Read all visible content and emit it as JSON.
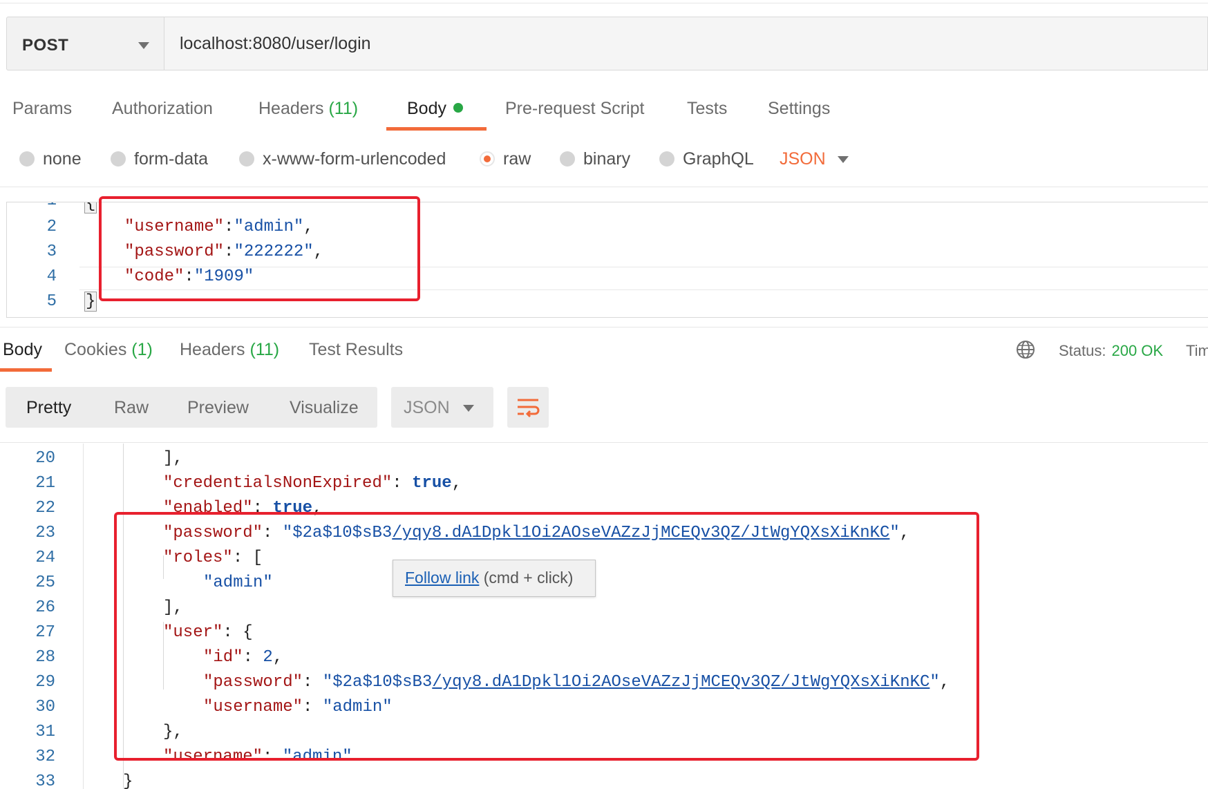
{
  "request": {
    "method": "POST",
    "url": "localhost:8080/user/login"
  },
  "request_tabs": {
    "params": "Params",
    "authorization": "Authorization",
    "headers": "Headers",
    "headers_count": "(11)",
    "body": "Body",
    "pre_request": "Pre-request Script",
    "tests": "Tests",
    "settings": "Settings"
  },
  "body_types": {
    "none": "none",
    "form_data": "form-data",
    "urlencoded": "x-www-form-urlencoded",
    "raw": "raw",
    "binary": "binary",
    "graphql": "GraphQL",
    "format": "JSON",
    "selected": "raw"
  },
  "request_body": {
    "line_numbers": [
      "1",
      "2",
      "3",
      "4",
      "5"
    ],
    "open": "{",
    "close": "}",
    "username_key": "\"username\"",
    "username_val": "\"admin\"",
    "password_key": "\"password\"",
    "password_val": "\"222222\"",
    "code_key": "\"code\"",
    "code_val": "\"1909\""
  },
  "response_tabs": {
    "body": "Body",
    "cookies": "Cookies",
    "cookies_count": "(1)",
    "headers": "Headers",
    "headers_count": "(11)",
    "test_results": "Test Results"
  },
  "status": {
    "label": "Status:",
    "value": "200 OK",
    "time_label_truncated": "Tim"
  },
  "view_modes": {
    "pretty": "Pretty",
    "raw": "Raw",
    "preview": "Preview",
    "visualize": "Visualize",
    "format": "JSON"
  },
  "response_body": {
    "line_numbers": [
      "20",
      "21",
      "22",
      "23",
      "24",
      "25",
      "26",
      "27",
      "28",
      "29",
      "30",
      "31",
      "32",
      "33"
    ],
    "credentials_key": "\"credentialsNonExpired\"",
    "enabled_key": "\"enabled\"",
    "true_val": "true",
    "password_key": "\"password\"",
    "hash_prefix": "\"$2a$10$sB3",
    "hash_link": "/yqy8.dA1Dpkl1Oi2AOseVAZzJjMCEQv3QZ/JtWgYQXsXiKnKC",
    "hash_suffix": "\"",
    "roles_key": "\"roles\"",
    "role_admin": "\"admin\"",
    "user_key": "\"user\"",
    "id_key": "\"id\"",
    "id_val": "2",
    "username_key": "\"username\"",
    "username_val": "\"admin\""
  },
  "tooltip": {
    "link_text": "Follow link",
    "hint": " (cmd + click)"
  },
  "colors": {
    "accent": "#f26b3a",
    "success": "#28a745",
    "highlight_box": "#e8202e",
    "json_key": "#a31515",
    "json_value": "#1750a5"
  }
}
